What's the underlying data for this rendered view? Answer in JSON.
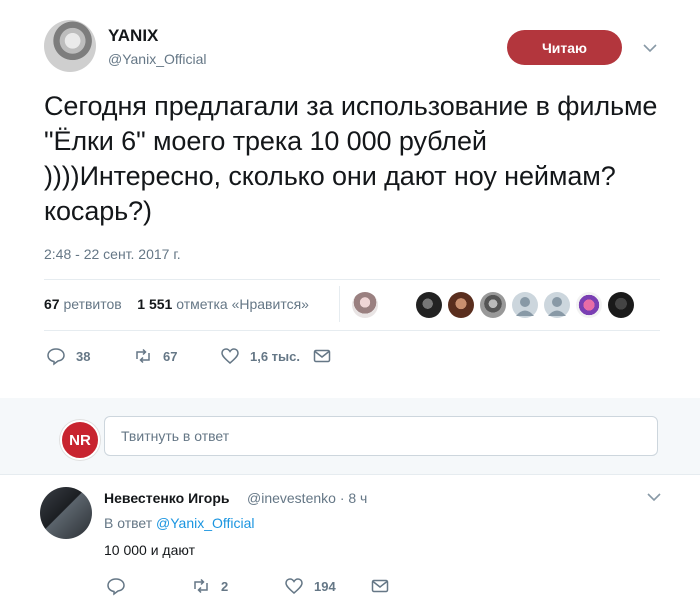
{
  "tweet": {
    "author_name": "YANIX",
    "author_handle": "@Yanix_Official",
    "follow_label": "Читаю",
    "text": "Сегодня предлагали за использование в фильме \"Ёлки 6\" моего трека 10 000 рублей ))))Интересно, сколько они дают ноу неймам?косарь?)",
    "timestamp": "2:48 - 22 сент. 2017 г.",
    "stats": {
      "retweets_count": "67",
      "retweets_label": "ретвитов",
      "likes_count": "1 551",
      "likes_label": "отметка «Нравится»"
    },
    "actions": {
      "replies": "38",
      "retweets": "67",
      "likes": "1,6 тыс."
    }
  },
  "reply_box": {
    "logo_text": "NR",
    "placeholder": "Твитнуть в ответ"
  },
  "reply": {
    "author_name": "Невестенко Игорь",
    "author_handle": "@inevestenko · 8 ч",
    "reply_to_prefix": "В ответ",
    "reply_to_handle": "@Yanix_Official",
    "text": "10 000 и дают",
    "actions": {
      "retweets": "2",
      "likes": "194"
    }
  },
  "colors": {
    "follow_button": "#b3363d",
    "link": "#1b95e0",
    "muted": "#657786",
    "nr_logo": "#c8242f"
  }
}
